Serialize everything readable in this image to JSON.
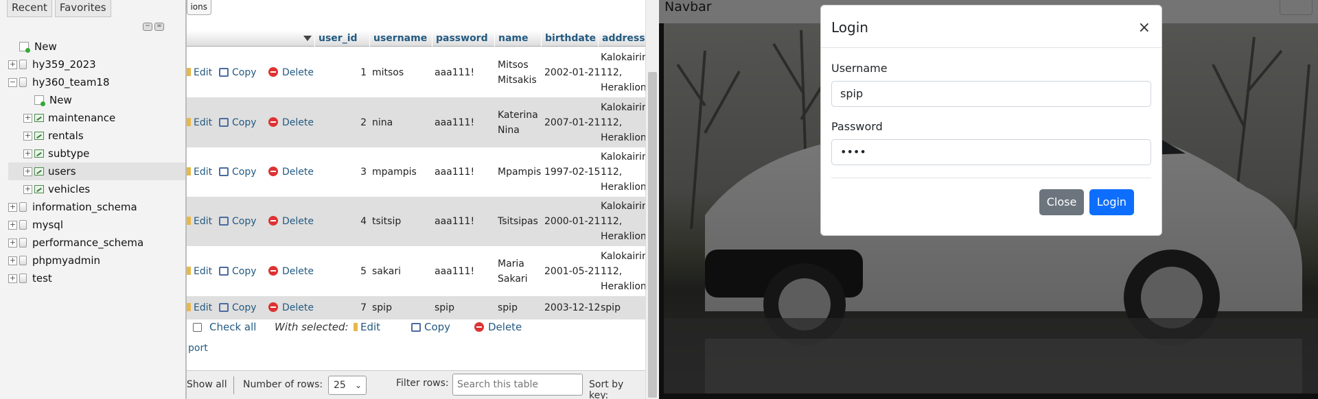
{
  "pma": {
    "nav_tabs": [
      "Recent",
      "Favorites"
    ],
    "tree": [
      {
        "label": "New",
        "kind": "new",
        "level": 0
      },
      {
        "label": "hy359_2023",
        "kind": "db",
        "level": 0,
        "expander": "+"
      },
      {
        "label": "hy360_team18",
        "kind": "db",
        "level": 0,
        "expander": "−"
      },
      {
        "label": "New",
        "kind": "new",
        "level": 1
      },
      {
        "label": "maintenance",
        "kind": "table",
        "level": 1,
        "expander": "+"
      },
      {
        "label": "rentals",
        "kind": "table",
        "level": 1,
        "expander": "+"
      },
      {
        "label": "subtype",
        "kind": "table",
        "level": 1,
        "expander": "+"
      },
      {
        "label": "users",
        "kind": "table",
        "level": 1,
        "expander": "+",
        "selected": true
      },
      {
        "label": "vehicles",
        "kind": "table",
        "level": 1,
        "expander": "+"
      },
      {
        "label": "information_schema",
        "kind": "db",
        "level": 0,
        "expander": "+"
      },
      {
        "label": "mysql",
        "kind": "db",
        "level": 0,
        "expander": "+"
      },
      {
        "label": "performance_schema",
        "kind": "db",
        "level": 0,
        "expander": "+"
      },
      {
        "label": "phpmyadmin",
        "kind": "db",
        "level": 0,
        "expander": "+"
      },
      {
        "label": "test",
        "kind": "db",
        "level": 0,
        "expander": "+"
      }
    ],
    "options_label": "ions",
    "columns": [
      "user_id",
      "username",
      "password",
      "name",
      "birthdate",
      "address"
    ],
    "actions": {
      "edit": "Edit",
      "copy": "Copy",
      "delete": "Delete"
    },
    "rows": [
      {
        "user_id": "1",
        "username": "mitsos",
        "password": "aaa111!",
        "name": [
          "Mitsos",
          "Mitsakis"
        ],
        "birthdate": "2002-01-21",
        "address": [
          "Kalokairino",
          "112,",
          "Heraklion"
        ]
      },
      {
        "user_id": "2",
        "username": "nina",
        "password": "aaa111!",
        "name": [
          "Katerina",
          "Nina"
        ],
        "birthdate": "2007-01-21",
        "address": [
          "Kalokairino",
          "112,",
          "Heraklion"
        ]
      },
      {
        "user_id": "3",
        "username": "mpampis",
        "password": "aaa111!",
        "name": [
          "Mpampis"
        ],
        "birthdate": "1997-02-15",
        "address": [
          "Kalokairino",
          "112,",
          "Heraklion"
        ]
      },
      {
        "user_id": "4",
        "username": "tsitsip",
        "password": "aaa111!",
        "name": [
          "Tsitsipas"
        ],
        "birthdate": "2000-01-21",
        "address": [
          "Kalokairino",
          "112,",
          "Heraklion"
        ]
      },
      {
        "user_id": "5",
        "username": "sakari",
        "password": "aaa111!",
        "name": [
          "Maria",
          "Sakari"
        ],
        "birthdate": "2001-05-21",
        "address": [
          "Kalokairino",
          "112,",
          "Heraklion"
        ]
      },
      {
        "user_id": "7",
        "username": "spip",
        "password": "spip",
        "name": [
          "spip"
        ],
        "birthdate": "2003-12-12",
        "address": [
          "spip"
        ]
      }
    ],
    "check_all": "Check all",
    "with_selected": "With selected:",
    "bulk": {
      "edit": "Edit",
      "copy": "Copy",
      "delete": "Delete"
    },
    "export_partial": "port",
    "footer": {
      "show_all": "Show all",
      "number_of_rows_label": "Number of rows:",
      "number_of_rows_value": "25",
      "filter_rows_label": "Filter rows:",
      "search_placeholder": "Search this table",
      "sort_by_key_label": "Sort by key:"
    }
  },
  "site": {
    "brand": "Navbar",
    "modal": {
      "title": "Login",
      "close_symbol": "×",
      "username_label": "Username",
      "username_value": "spip",
      "password_label": "Password",
      "password_value": "••••",
      "close_button": "Close",
      "login_button": "Login"
    }
  }
}
